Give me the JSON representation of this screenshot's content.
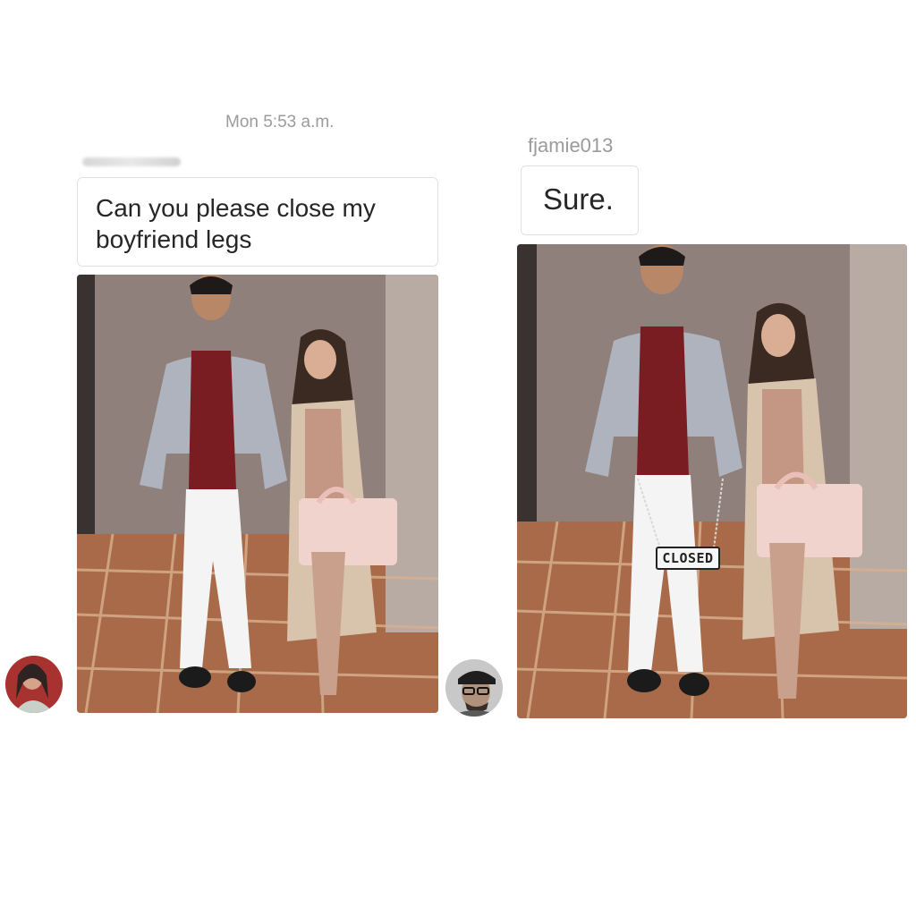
{
  "left_panel": {
    "timestamp": "Mon 5:53 a.m.",
    "message": "Can you please close my boyfriend legs",
    "photo_description": "couple-photo-original",
    "avatar": "user-avatar"
  },
  "right_panel": {
    "username": "fjamie013",
    "message": "Sure.",
    "photo_description": "couple-photo-edited",
    "sign_text": "CLOSED",
    "avatar": "fjamie013-avatar"
  },
  "colors": {
    "bubble_border": "#e1e1e1",
    "text": "#262626",
    "muted_text": "#9b9b9b"
  }
}
